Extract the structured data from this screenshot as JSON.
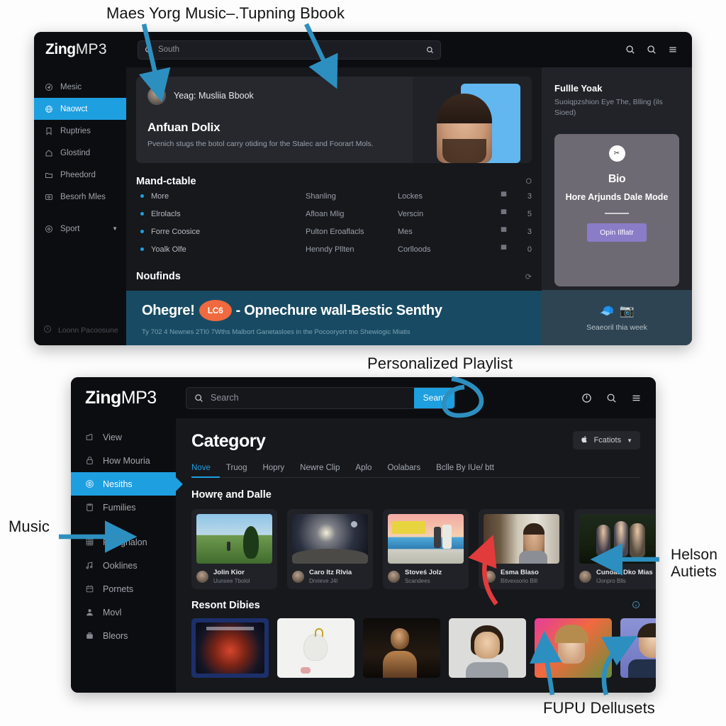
{
  "annotations": [
    {
      "id": "ann-top",
      "text": "Maes Yorg Music–.Tupning Bbook"
    },
    {
      "id": "ann-playlist",
      "text": "Personalized Playlist"
    },
    {
      "id": "ann-music",
      "text": "Music"
    },
    {
      "id": "ann-helson",
      "text": "Helson\nAutiets"
    },
    {
      "id": "ann-helson-l1",
      "text": "Helson"
    },
    {
      "id": "ann-helson-l2",
      "text": "Autiets"
    },
    {
      "id": "ann-fupu",
      "text": "FUPU Dellusets"
    }
  ],
  "window1": {
    "brand": {
      "name": "Zing",
      "suffix": "MP3"
    },
    "search": {
      "placeholder": "South",
      "icon_left": "search-icon",
      "icon_right": "search-icon"
    },
    "header_icons": [
      "search-icon",
      "search-icon",
      "menu-icon"
    ],
    "sidebar": {
      "items": [
        {
          "label": "Mesic",
          "icon": "compass-icon",
          "active": false
        },
        {
          "label": "Naowct",
          "icon": "globe-icon",
          "active": true
        },
        {
          "label": "Ruptries",
          "icon": "bookmark-icon",
          "active": false
        },
        {
          "label": "Glostind",
          "icon": "home-icon",
          "active": false
        },
        {
          "label": "Pheedord",
          "icon": "folder-icon",
          "active": false
        },
        {
          "label": "Besorh Mles",
          "icon": "badge-icon",
          "active": false
        },
        {
          "label": "Sport",
          "icon": "disc-icon",
          "active": false,
          "chevron": "▼"
        }
      ],
      "footer": {
        "label": "Loonn Pacoosune",
        "icon": "clock-icon"
      }
    },
    "hero": {
      "user_name": "Yeag: Musliia Bbook",
      "title": "Anfuan Dolix",
      "subtitle": "Pvenich stugs the botol carry otiding for the Stalec and Foorart Mols."
    },
    "table": {
      "title": "Mand-ctable",
      "action": "O",
      "rows": [
        {
          "c1": "More",
          "c2": "Shanling",
          "c3": "Lockes",
          "flag": "flag-icon",
          "num": "3"
        },
        {
          "c1": "Elrolacls",
          "c2": "Afloan Mlig",
          "c3": "Verscin",
          "flag": "flag-icon",
          "num": "5"
        },
        {
          "c1": "Forre Coosice",
          "c2": "Pulton Eroaflacls",
          "c3": "Mes",
          "flag": "flag-icon",
          "num": "3"
        },
        {
          "c1": "Yoalk Olfe",
          "c2": "Henndy Pllten",
          "c3": "Corlloods",
          "flag": "flag-icon",
          "num": "0"
        }
      ]
    },
    "section2": {
      "title": "Noufinds",
      "action": "⟳"
    },
    "banner": {
      "heading_pre": "Ohegre!",
      "pill": "LC6",
      "heading_post": "- Opnechure wall-Bestic Senthy",
      "sub": "Ty 702 4 Newnes 2TI0 7Wths Malbort Ganetasloes in the Pocooryort tno Shewiogic Miatis"
    },
    "right_panel": {
      "title": "Fullle Yoak",
      "subtitle": "Suoiqpzshion Eye The, Blling (ils Sioed)",
      "promo": {
        "badge": "✂",
        "logo": "Bio",
        "title": "Hore Arjunds Dale Mode",
        "button": "Opin Ilflatr"
      },
      "footer": {
        "emojis": [
          "🧢",
          "📷"
        ],
        "label": "Seaeoril thia week"
      }
    }
  },
  "window2": {
    "brand": {
      "name": "Zing",
      "suffix": "MP3"
    },
    "search": {
      "placeholder": "Search",
      "button": "Seant",
      "icon": "search-icon"
    },
    "header_icons": [
      "power-icon",
      "search-icon",
      "menu-icon"
    ],
    "sidebar": {
      "items": [
        {
          "label": "View",
          "icon": "folder-icon",
          "active": false
        },
        {
          "label": "How Mouria",
          "icon": "lock-icon",
          "active": false
        },
        {
          "label": "Nesiths",
          "icon": "spiral-icon",
          "active": true
        },
        {
          "label": "Fumilies",
          "icon": "clipboard-icon",
          "active": false
        },
        {
          "label": "Pleagnalon",
          "icon": "grid-icon",
          "active": false,
          "gap_before": true
        },
        {
          "label": "Ooklines",
          "icon": "music-note-icon",
          "active": false
        },
        {
          "label": "Pornets",
          "icon": "calendar-icon",
          "active": false
        },
        {
          "label": "Movl",
          "icon": "user-icon",
          "active": false
        },
        {
          "label": "Bleors",
          "icon": "briefcase-icon",
          "active": false
        }
      ]
    },
    "page_title": "Category",
    "filter_button": {
      "label": "Fcatiots",
      "icon": "apple-icon",
      "chevron": "▼"
    },
    "tabs": [
      {
        "label": "Nove",
        "active": true
      },
      {
        "label": "Truog",
        "active": false
      },
      {
        "label": "Hopry",
        "active": false
      },
      {
        "label": "Newre Clip",
        "active": false
      },
      {
        "label": "Aplo",
        "active": false
      },
      {
        "label": "Oolabars",
        "active": false
      },
      {
        "label": "Bclle By IUe/ btt",
        "active": false
      }
    ],
    "block1": {
      "title": "Howrę and Dalle",
      "cards": [
        {
          "name": "Jolin Kior",
          "desc": "Uunsee Tbolol",
          "theme": "landscape"
        },
        {
          "name": "Caro Itz Rlvia",
          "desc": "Dnrieve J4l",
          "theme": "night"
        },
        {
          "name": "Stoveś Jolz",
          "desc": "Scandees",
          "theme": "poster"
        },
        {
          "name": "Esma Blaso",
          "desc": "Bitvexsorio Blll",
          "theme": "room"
        },
        {
          "name": "Cunoao Dko Mias",
          "desc": "IJonpro Blls",
          "theme": "group"
        }
      ]
    },
    "block2": {
      "title": "Resont Dibies",
      "action_icon": "info-icon",
      "items": [
        {
          "theme": "album"
        },
        {
          "theme": "bird"
        },
        {
          "theme": "dark-portrait"
        },
        {
          "theme": "gray-portrait"
        },
        {
          "theme": "flower"
        },
        {
          "theme": "suit"
        }
      ]
    }
  }
}
